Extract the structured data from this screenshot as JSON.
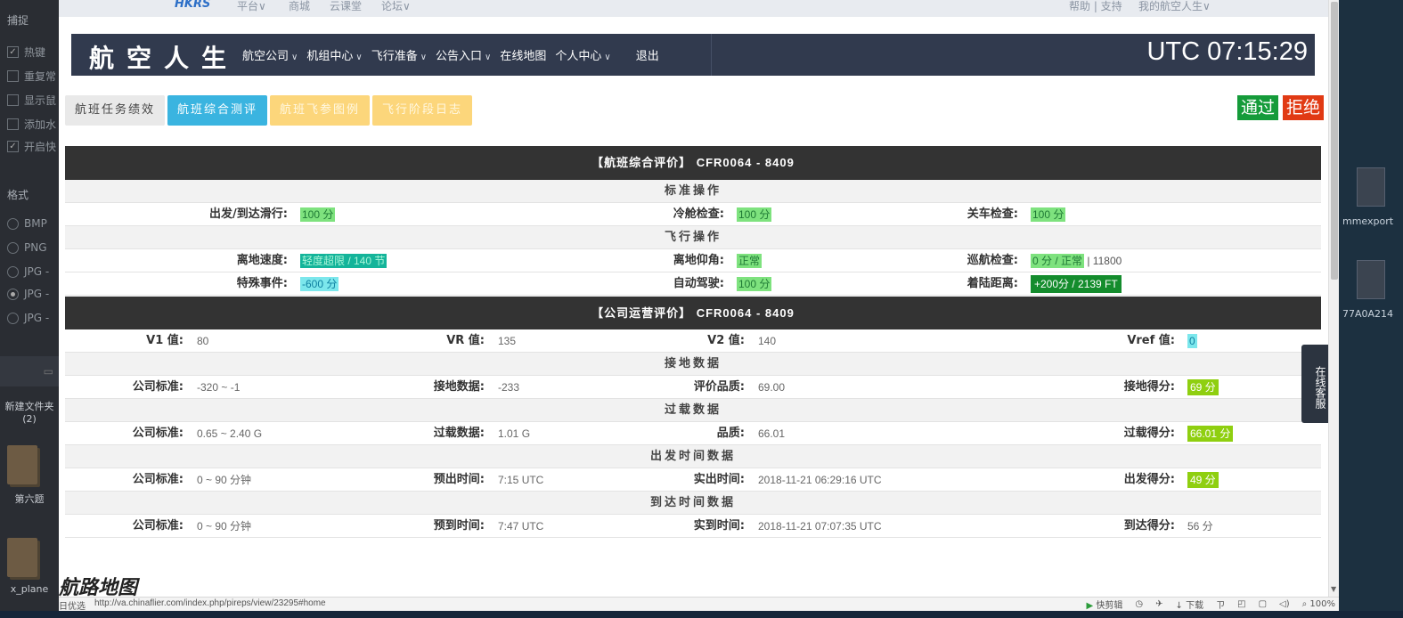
{
  "left_panel": {
    "section1": "捕捉",
    "options1": [
      {
        "label": "热键",
        "checked": true
      },
      {
        "label": "重复常",
        "checked": false
      },
      {
        "label": "显示鼠",
        "checked": false
      },
      {
        "label": "添加水",
        "checked": false
      },
      {
        "label": "开启快",
        "checked": true
      }
    ],
    "section2": "格式",
    "formats": [
      {
        "label": "BMP",
        "selected": false
      },
      {
        "label": "PNG",
        "selected": false
      },
      {
        "label": "JPG -",
        "selected": false
      },
      {
        "label": "JPG -",
        "selected": true
      },
      {
        "label": "JPG -",
        "selected": false
      }
    ],
    "desktop_items": [
      "新建文件夹\n(2)",
      "第六题",
      "x_plane"
    ]
  },
  "right_panel": {
    "desktop_items": [
      "mmexport",
      "77A0A214"
    ]
  },
  "topbar": {
    "logo": "HKRS",
    "links": [
      "平台∨",
      "商城",
      "云课堂",
      "论坛∨"
    ],
    "right_links": [
      "帮助 | 支持",
      "我的航空人生∨"
    ]
  },
  "header": {
    "brand": "航空人生",
    "menu": [
      {
        "label": "航空公司",
        "caret": true
      },
      {
        "label": "机组中心",
        "caret": true
      },
      {
        "label": "飞行准备",
        "caret": true
      },
      {
        "label": "公告入口",
        "caret": true
      },
      {
        "label": "在线地图",
        "caret": false
      },
      {
        "label": "个人中心",
        "caret": true
      },
      {
        "label": "退出",
        "caret": false
      }
    ],
    "utc": "UTC 07:15:29"
  },
  "tabs": [
    "航班任务绩效",
    "航班综合测评",
    "航班飞参图例",
    "飞行阶段日志"
  ],
  "actions": {
    "pass": "通过",
    "reject": "拒绝"
  },
  "flight_eval": {
    "title": "【航班综合评价】",
    "id": "CFR0064 - 8409",
    "standard_ops": "标准操作",
    "taxi_label": "出发/到达滑行:",
    "taxi_value": "100 分",
    "cold_label": "冷舱检查:",
    "cold_value": "100 分",
    "shutdown_label": "关车检查:",
    "shutdown_value": "100 分",
    "flight_ops": "飞行操作",
    "liftoff_speed_label": "离地速度:",
    "liftoff_speed_value": "轻度超限 / 140 节",
    "liftoff_pitch_label": "离地仰角:",
    "liftoff_pitch_value": "正常",
    "cruise_label": "巡航检查:",
    "cruise_value": "0 分 / 正常",
    "cruise_extra": "| 11800",
    "special_label": "特殊事件:",
    "special_value": "-600 分",
    "autopilot_label": "自动驾驶:",
    "autopilot_value": "100 分",
    "landing_dist_label": "着陆距离:",
    "landing_dist_value": "+200分 / 2139 FT"
  },
  "ops_eval": {
    "title": "【公司运营评价】",
    "id": "CFR0064 - 8409",
    "v1_label": "V1 值:",
    "v1_value": "80",
    "vr_label": "VR 值:",
    "vr_value": "135",
    "v2_label": "V2 值:",
    "v2_value": "140",
    "vref_label": "Vref 值:",
    "vref_value": "0",
    "touchdown_head": "接地数据",
    "td_std_label": "公司标准:",
    "td_std_value": "-320 ~ -1",
    "td_data_label": "接地数据:",
    "td_data_value": "-233",
    "td_quality_label": "评价品质:",
    "td_quality_value": "69.00",
    "td_score_label": "接地得分:",
    "td_score_value": "69 分",
    "overload_head": "过载数据",
    "ol_std_label": "公司标准:",
    "ol_std_value": "0.65 ~ 2.40 G",
    "ol_data_label": "过载数据:",
    "ol_data_value": "1.01 G",
    "ol_quality_label": "品质:",
    "ol_quality_value": "66.01",
    "ol_score_label": "过载得分:",
    "ol_score_value": "66.01 分",
    "departure_head": "出发时间数据",
    "dep_std_label": "公司标准:",
    "dep_std_value": "0 ~ 90 分钟",
    "dep_plan_label": "预出时间:",
    "dep_plan_value": "7:15 UTC",
    "dep_actual_label": "实出时间:",
    "dep_actual_value": "2018-11-21 06:29:16 UTC",
    "dep_score_label": "出发得分:",
    "dep_score_value": "49 分",
    "arrival_head": "到达时间数据",
    "arr_std_label": "公司标准:",
    "arr_std_value": "0 ~ 90 分钟",
    "arr_plan_label": "预到时间:",
    "arr_plan_value": "7:47 UTC",
    "arr_actual_label": "实到时间:",
    "arr_actual_value": "2018-11-21 07:07:35 UTC",
    "arr_score_label": "到达得分:",
    "arr_score_value": "56 分"
  },
  "service_tab": "在线客服",
  "route_title": "航路地图",
  "statusbar": {
    "prefix": "日优选",
    "url": "http://va.chinaflier.com/index.php/pireps/view/23295#home",
    "tools": [
      "快剪辑",
      "下载",
      "100%"
    ]
  }
}
